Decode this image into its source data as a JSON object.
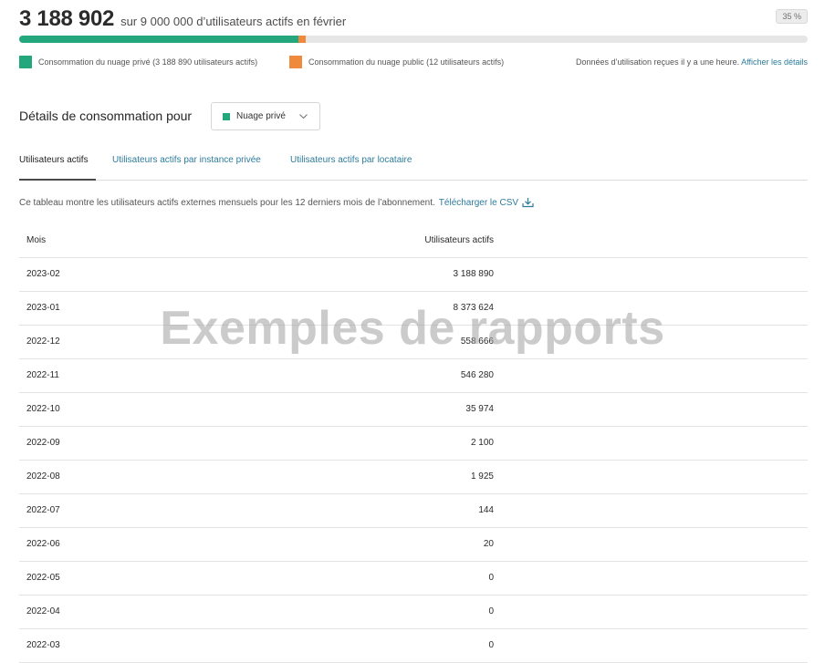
{
  "header": {
    "active_users": "3 188 902",
    "subtitle": "sur 9 000 000 d’utilisateurs actifs en février",
    "percent_badge": "35 %",
    "private_fraction": 0.354
  },
  "legend": {
    "private_label": "Consommation du nuage privé (3 188 890 utilisateurs actifs)",
    "public_label": "Consommation du nuage public (12 utilisateurs actifs)",
    "usage_note": "Données d’utilisation reçues il y a une heure.",
    "details_link": "Afficher les détails"
  },
  "details": {
    "title": "Détails de consommation pour",
    "dropdown_value": "Nuage privé"
  },
  "tabs": [
    {
      "label": "Utilisateurs actifs"
    },
    {
      "label": "Utilisateurs actifs par instance privée"
    },
    {
      "label": "Utilisateurs actifs par locataire"
    }
  ],
  "description": {
    "text": "Ce tableau montre les utilisateurs actifs externes mensuels pour les 12 derniers mois de l’abonnement.",
    "csv_link": "Télécharger le CSV"
  },
  "table": {
    "col_month": "Mois",
    "col_users": "Utilisateurs actifs",
    "rows": [
      {
        "month": "2023-02",
        "users": "3 188 890"
      },
      {
        "month": "2023-01",
        "users": "8 373 624"
      },
      {
        "month": "2022-12",
        "users": "558 666"
      },
      {
        "month": "2022-11",
        "users": "546 280"
      },
      {
        "month": "2022-10",
        "users": "35 974"
      },
      {
        "month": "2022-09",
        "users": "2 100"
      },
      {
        "month": "2022-08",
        "users": "1 925"
      },
      {
        "month": "2022-07",
        "users": "144"
      },
      {
        "month": "2022-06",
        "users": "20"
      },
      {
        "month": "2022-05",
        "users": "0"
      },
      {
        "month": "2022-04",
        "users": "0"
      },
      {
        "month": "2022-03",
        "users": "0"
      }
    ]
  },
  "watermark": "Exemples de rapports",
  "colors": {
    "private": "#24a77d",
    "public": "#ef8a3c",
    "link": "#2d7c9c"
  }
}
